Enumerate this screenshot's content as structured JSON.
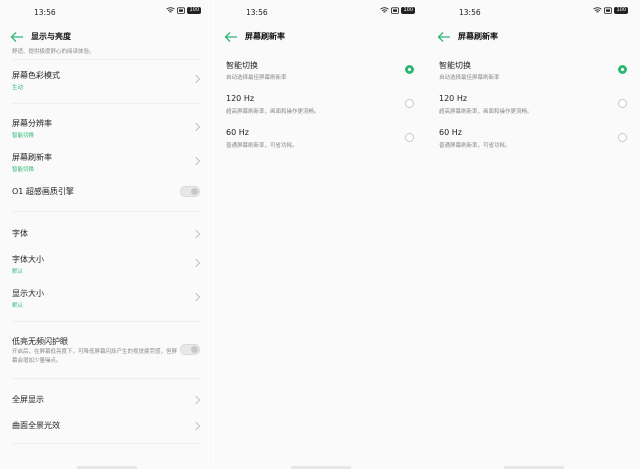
{
  "status": {
    "time": "13:56",
    "battery": "100"
  },
  "display": {
    "title": "显示与亮度",
    "intro": "舒适、提供极度舒心的阅读体验。",
    "color_mode": {
      "label": "屏幕色彩模式",
      "value": "生动"
    },
    "resolution": {
      "label": "屏幕分辨率",
      "value": "智能切换"
    },
    "refresh": {
      "label": "屏幕刷新率",
      "value": "智能切换"
    },
    "o1_engine": {
      "label": "O1 超感画质引擎"
    },
    "font": {
      "label": "字体"
    },
    "font_size": {
      "label": "字体大小",
      "value": "默认"
    },
    "display_size": {
      "label": "显示大小",
      "value": "默认"
    },
    "dc_dimming": {
      "label": "低亮无频闪护眼",
      "desc": "开启后，在屏幕低亮度下，可降低屏幕闪烁产生的视觉疲劳感，但屏幕会增加少量噪点。"
    },
    "fullscreen": {
      "label": "全屏显示"
    },
    "curved": {
      "label": "曲面全景光效"
    }
  },
  "refresh_page": {
    "title": "屏幕刷新率",
    "options": [
      {
        "label": "智能切换",
        "desc": "自动选择最佳屏幕刷新率"
      },
      {
        "label": "120 Hz",
        "desc": "超高屏幕刷新率，画面和操作更流畅。"
      },
      {
        "label": "60 Hz",
        "desc": "普通屏幕刷新率，可省功耗。"
      }
    ],
    "selected": "智能切换"
  },
  "colors": {
    "accent": "#2fb773",
    "text": "#222222",
    "secondary": "#888888"
  },
  "icons": [
    "back-arrow-icon",
    "chevron-right-icon",
    "wifi-icon",
    "signal-icon",
    "battery-icon"
  ]
}
